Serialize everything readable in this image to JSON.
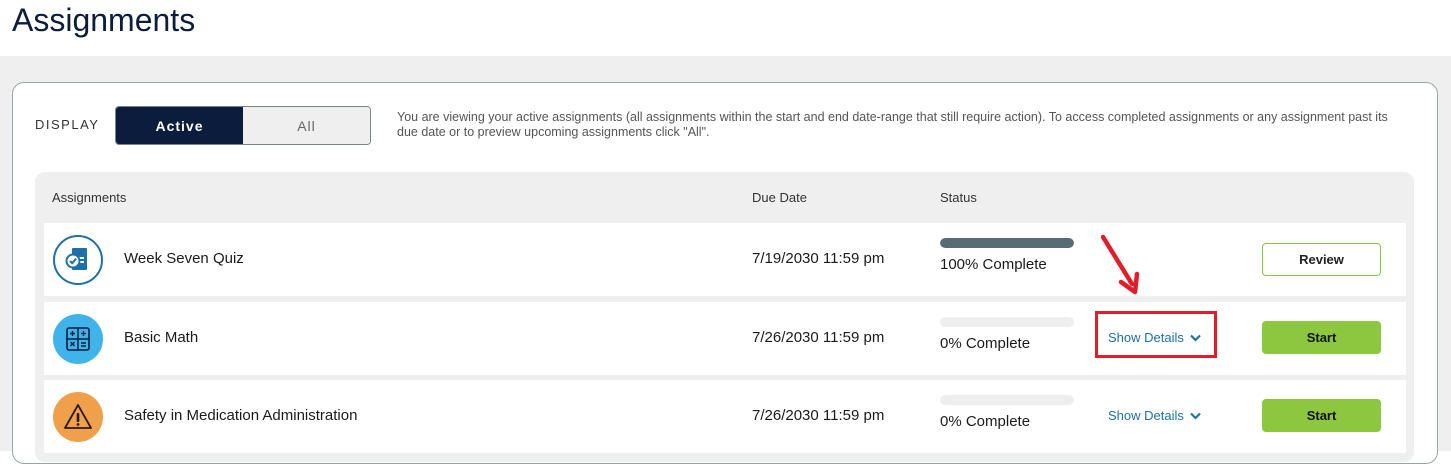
{
  "page": {
    "title": "Assignments"
  },
  "display": {
    "label": "DISPLAY",
    "active_label": "Active",
    "all_label": "All",
    "info": "You are viewing your active assignments (all assignments within the start and end date-range that still require action). To access completed assignments or any assignment past its due date or to preview upcoming assignments click \"All\"."
  },
  "table": {
    "headers": {
      "assignments": "Assignments",
      "due_date": "Due Date",
      "status": "Status"
    },
    "rows": [
      {
        "title": "Week Seven Quiz",
        "due": "7/19/2030 11:59 pm",
        "status": "100% Complete",
        "progress": 1.0,
        "action": "Review",
        "icon": "quiz-document-icon",
        "icon_color": "#ffffff"
      },
      {
        "title": "Basic Math",
        "due": "7/26/2030 11:59 pm",
        "status": "0% Complete",
        "progress": 0.0,
        "details": "Show Details",
        "action": "Start",
        "icon": "calculator-icon",
        "icon_color": "#3fb3ea"
      },
      {
        "title": "Safety in Medication Administration",
        "due": "7/26/2030 11:59 pm",
        "status": "0% Complete",
        "progress": 0.0,
        "details": "Show Details",
        "action": "Start",
        "icon": "warning-icon",
        "icon_color": "#f0a04b"
      }
    ]
  },
  "colors": {
    "brand_navy": "#0b1c3d",
    "accent_green": "#8dc63f",
    "link_blue": "#1f6fa8",
    "annotation_red": "#e11d2a"
  }
}
